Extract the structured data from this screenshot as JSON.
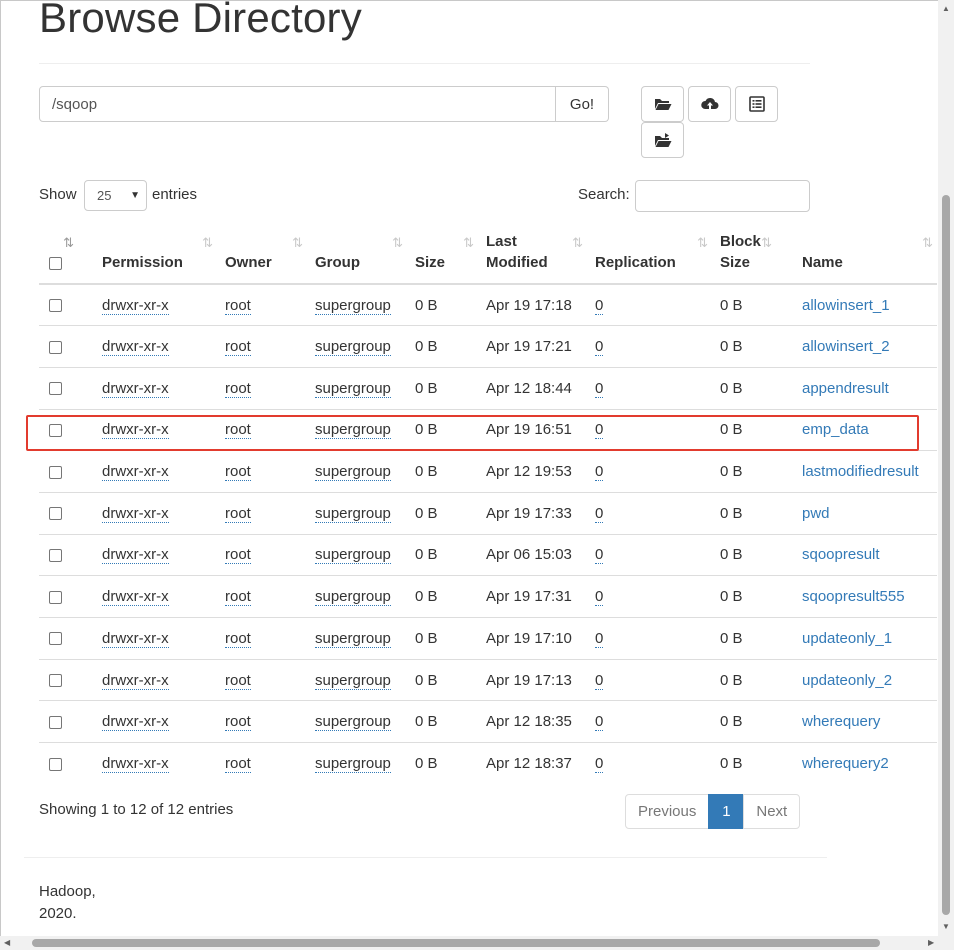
{
  "page": {
    "title": "Browse Directory"
  },
  "path_bar": {
    "value": "/sqoop",
    "go_label": "Go!"
  },
  "toolbar": {
    "buttons": [
      {
        "name": "create-directory-button",
        "icon": "folder-open-icon"
      },
      {
        "name": "upload-button",
        "icon": "cloud-upload-icon"
      },
      {
        "name": "cut-paste-button",
        "icon": "list-alt-icon"
      },
      {
        "name": "paste-button",
        "icon": "folder-move-icon"
      }
    ]
  },
  "length_menu": {
    "show": "Show",
    "selected": "25",
    "entries": "entries"
  },
  "search": {
    "label": "Search:",
    "value": ""
  },
  "table": {
    "headers": [
      "",
      "Permission",
      "Owner",
      "Group",
      "Size",
      "Last Modified",
      "Replication",
      "Block Size",
      "Name"
    ],
    "header_lines": {
      "last_modified": [
        "Last",
        "Modified"
      ],
      "block_size": [
        "Block",
        "Size"
      ]
    },
    "sort_icon": "⇅",
    "rows": [
      {
        "permission": "drwxr-xr-x",
        "owner": "root",
        "group": "supergroup",
        "size": "0 B",
        "modified": "Apr 19 17:18",
        "replication": "0",
        "block_size": "0 B",
        "name": "allowinsert_1"
      },
      {
        "permission": "drwxr-xr-x",
        "owner": "root",
        "group": "supergroup",
        "size": "0 B",
        "modified": "Apr 19 17:21",
        "replication": "0",
        "block_size": "0 B",
        "name": "allowinsert_2"
      },
      {
        "permission": "drwxr-xr-x",
        "owner": "root",
        "group": "supergroup",
        "size": "0 B",
        "modified": "Apr 12 18:44",
        "replication": "0",
        "block_size": "0 B",
        "name": "appendresult"
      },
      {
        "permission": "drwxr-xr-x",
        "owner": "root",
        "group": "supergroup",
        "size": "0 B",
        "modified": "Apr 19 16:51",
        "replication": "0",
        "block_size": "0 B",
        "name": "emp_data"
      },
      {
        "permission": "drwxr-xr-x",
        "owner": "root",
        "group": "supergroup",
        "size": "0 B",
        "modified": "Apr 12 19:53",
        "replication": "0",
        "block_size": "0 B",
        "name": "lastmodifiedresult"
      },
      {
        "permission": "drwxr-xr-x",
        "owner": "root",
        "group": "supergroup",
        "size": "0 B",
        "modified": "Apr 19 17:33",
        "replication": "0",
        "block_size": "0 B",
        "name": "pwd"
      },
      {
        "permission": "drwxr-xr-x",
        "owner": "root",
        "group": "supergroup",
        "size": "0 B",
        "modified": "Apr 06 15:03",
        "replication": "0",
        "block_size": "0 B",
        "name": "sqoopresult"
      },
      {
        "permission": "drwxr-xr-x",
        "owner": "root",
        "group": "supergroup",
        "size": "0 B",
        "modified": "Apr 19 17:31",
        "replication": "0",
        "block_size": "0 B",
        "name": "sqoopresult555"
      },
      {
        "permission": "drwxr-xr-x",
        "owner": "root",
        "group": "supergroup",
        "size": "0 B",
        "modified": "Apr 19 17:10",
        "replication": "0",
        "block_size": "0 B",
        "name": "updateonly_1"
      },
      {
        "permission": "drwxr-xr-x",
        "owner": "root",
        "group": "supergroup",
        "size": "0 B",
        "modified": "Apr 19 17:13",
        "replication": "0",
        "block_size": "0 B",
        "name": "updateonly_2"
      },
      {
        "permission": "drwxr-xr-x",
        "owner": "root",
        "group": "supergroup",
        "size": "0 B",
        "modified": "Apr 12 18:35",
        "replication": "0",
        "block_size": "0 B",
        "name": "wherequery"
      },
      {
        "permission": "drwxr-xr-x",
        "owner": "root",
        "group": "supergroup",
        "size": "0 B",
        "modified": "Apr 12 18:37",
        "replication": "0",
        "block_size": "0 B",
        "name": "wherequery2"
      }
    ],
    "highlighted_row": "emp_data"
  },
  "info": {
    "text": "Showing 1 to 12 of 12 entries"
  },
  "pagination": {
    "previous": "Previous",
    "current": "1",
    "next": "Next"
  },
  "footer": {
    "line1": "Hadoop,",
    "line2": "2020."
  },
  "colors": {
    "link": "#337ab7",
    "highlight_border": "#e23b2e",
    "active_page": "#337ab7"
  }
}
